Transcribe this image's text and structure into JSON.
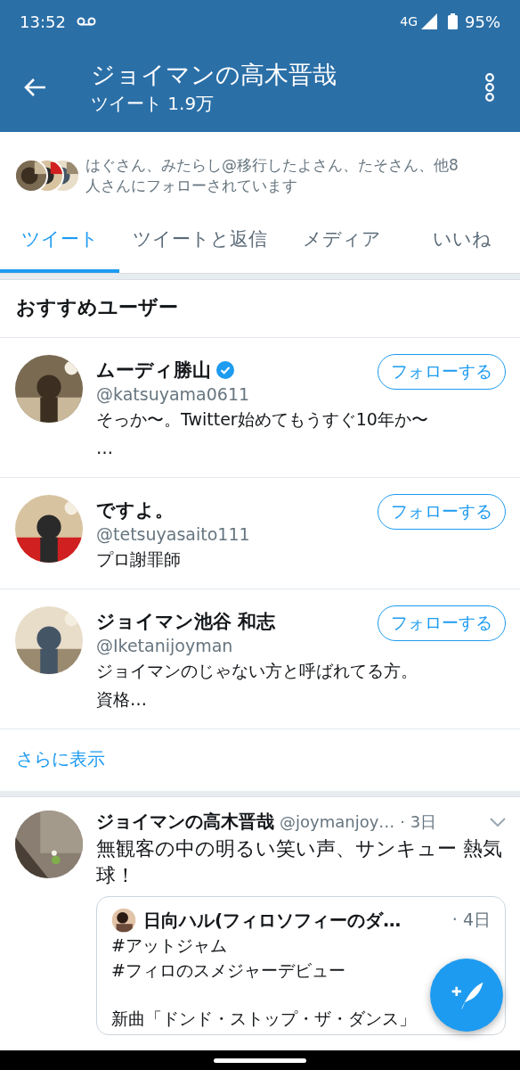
{
  "status_bar": {
    "time": "13:52",
    "network": "4G",
    "battery": "95%"
  },
  "app_bar": {
    "title": "ジョイマンの高木晋哉",
    "subtitle": "ツイート 1.9万"
  },
  "followed_by": {
    "text": "はぐさん、みたらし@移行したよさん、たそさん、他8人さんにフォローされています"
  },
  "tabs": [
    {
      "label": "ツイート",
      "selected": true
    },
    {
      "label": "ツイートと返信",
      "selected": false
    },
    {
      "label": "メディア",
      "selected": false
    },
    {
      "label": "いいね",
      "selected": false
    }
  ],
  "recommended": {
    "heading": "おすすめユーザー",
    "users": [
      {
        "name": "ムーディ勝山",
        "verified": true,
        "handle": "@katsuyama0611",
        "bio_lines": [
          "そっか〜。Twitter始めてもうすぐ10年か〜",
          "…"
        ],
        "button": "フォローする"
      },
      {
        "name": "ですよ。",
        "verified": false,
        "handle": "@tetsuyasaito111",
        "bio_lines": [
          "プロ謝罪師"
        ],
        "button": "フォローする"
      },
      {
        "name": "ジョイマン池谷 和志",
        "verified": false,
        "handle": "@Iketanijoyman",
        "bio_lines": [
          "ジョイマンのじゃない方と呼ばれてる方。",
          "資格…"
        ],
        "button": "フォローする"
      }
    ],
    "more": "さらに表示"
  },
  "tweets": [
    {
      "name": "ジョイマンの高木晋哉",
      "handle": "@joymanjoy…",
      "time": "· 3日",
      "text": "無観客の中の明るい笑い声、サンキュー 熱気球！",
      "quote": {
        "name": "日向ハル(フィロソフィーのダ…",
        "time": "· 4日",
        "lines": [
          {
            "text": "#アットジャム",
            "gap_before": false
          },
          {
            "text": "#フィロのスメジャーデビュー",
            "gap_before": false
          },
          {
            "text": "新曲「ドンド・ストップ・ザ・ダンス」",
            "gap_before": true
          }
        ]
      }
    }
  ]
}
